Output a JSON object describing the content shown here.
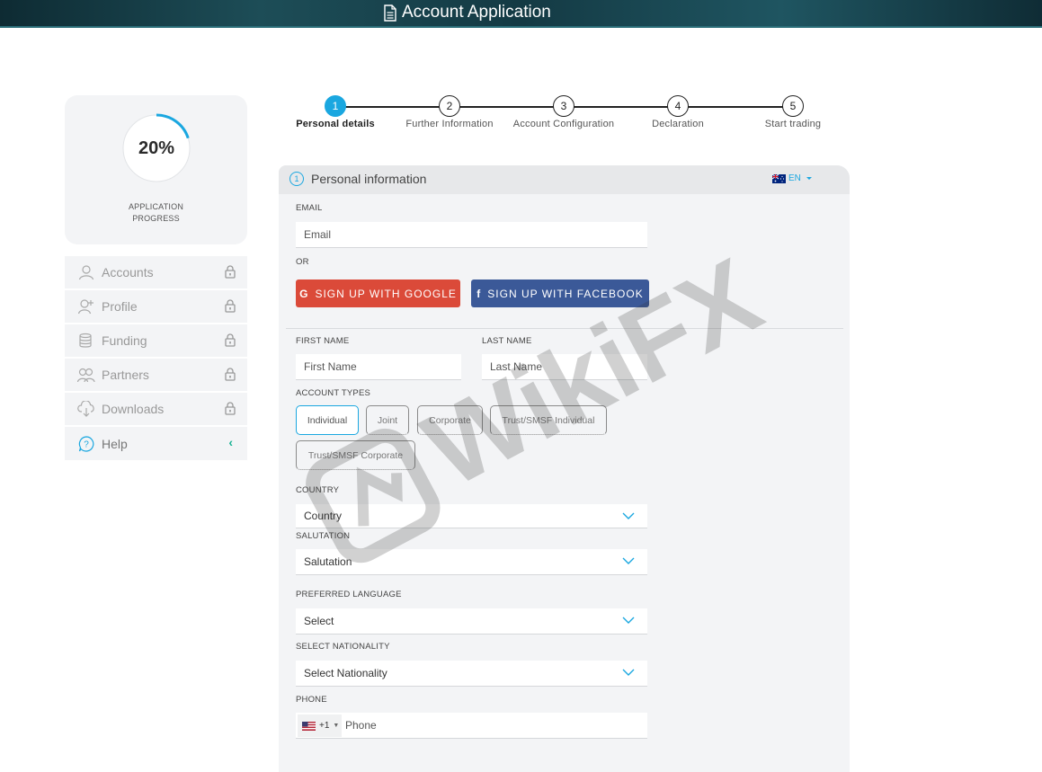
{
  "header": {
    "title": "Account Application"
  },
  "progress": {
    "percent": 20,
    "value_label": "20%",
    "label": "APPLICATION PROGRESS",
    "accent": "#1aa7e0"
  },
  "sidebar": {
    "items": [
      {
        "label": "Accounts",
        "icon": "user-icon",
        "locked": true
      },
      {
        "label": "Profile",
        "icon": "user-plus-icon",
        "locked": true
      },
      {
        "label": "Funding",
        "icon": "coins-icon",
        "locked": true
      },
      {
        "label": "Partners",
        "icon": "users-icon",
        "locked": true
      },
      {
        "label": "Downloads",
        "icon": "cloud-download-icon",
        "locked": true
      }
    ],
    "help": {
      "label": "Help",
      "icon": "help-icon"
    }
  },
  "stepper": {
    "steps": [
      {
        "num": "1",
        "label": "Personal details",
        "active": true
      },
      {
        "num": "2",
        "label": "Further Information",
        "active": false
      },
      {
        "num": "3",
        "label": "Account Configuration",
        "active": false
      },
      {
        "num": "4",
        "label": "Declaration",
        "active": false
      },
      {
        "num": "5",
        "label": "Start trading",
        "active": false
      }
    ]
  },
  "form": {
    "section_num": "1",
    "section_title": "Personal information",
    "language": {
      "code": "EN",
      "flag": "australia-flag-icon"
    },
    "email": {
      "label": "EMAIL",
      "placeholder": "Email"
    },
    "or_label": "OR",
    "google": {
      "label": "SIGN UP WITH GOOGLE",
      "icon": "G",
      "color": "#db4a39"
    },
    "facebook": {
      "label": "SIGN UP WITH FACEBOOK",
      "icon": "f",
      "color": "#3b5998"
    },
    "first_name": {
      "label": "FIRST NAME",
      "placeholder": "First Name"
    },
    "last_name": {
      "label": "LAST NAME",
      "placeholder": "Last Name"
    },
    "account_types": {
      "label": "ACCOUNT TYPES",
      "options": [
        "Individual",
        "Joint",
        "Corporate",
        "Trust/SMSF Individual",
        "Trust/SMSF Corporate"
      ],
      "selected": "Individual"
    },
    "country": {
      "label": "COUNTRY",
      "value": "Country"
    },
    "salutation": {
      "label": "SALUTATION",
      "value": "Salutation"
    },
    "preferred_language": {
      "label": "PREFERRED LANGUAGE",
      "value": "Select"
    },
    "nationality": {
      "label": "SELECT NATIONALITY",
      "value": "Select Nationality"
    },
    "phone": {
      "label": "PHONE",
      "country_code": "+1",
      "flag": "us-flag-icon",
      "placeholder": "Phone"
    }
  },
  "watermark": {
    "text": "WikiFX"
  }
}
